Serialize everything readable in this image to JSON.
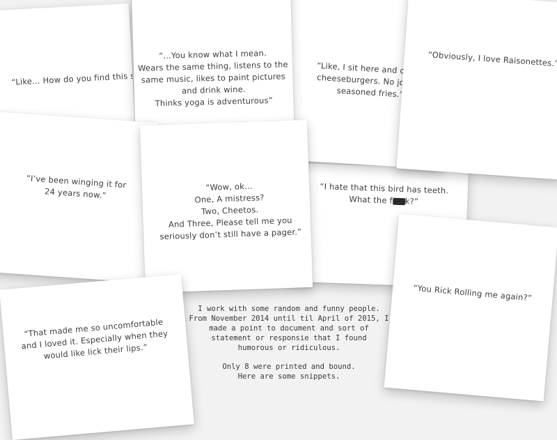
{
  "cards": [
    {
      "id": "bird",
      "lines": [
        "“I hate that this bird has teeth.",
        "What the f"
      ],
      "redacted_tail": "k?”"
    },
    {
      "id": "cheeseburgers",
      "lines": [
        "“Like, I sit here and dream",
        "cheeseburgers. No joke. A",
        "seasoned fries.”"
      ]
    },
    {
      "id": "find-this",
      "lines": [
        "“Like… How do you find this sh"
      ]
    },
    {
      "id": "raisonettes",
      "lines": [
        "“Obviously, I love Raisonettes.”"
      ]
    },
    {
      "id": "you-know",
      "lines": [
        "“...You know what I mean.",
        "Wears the same thing, listens to the",
        "same music, likes to paint pictures",
        "and drink wine.",
        "Thinks yoga is adventurous”"
      ]
    },
    {
      "id": "winging",
      "lines": [
        "“I’ve been winging it for",
        "24 years now.”"
      ]
    },
    {
      "id": "mistress",
      "lines": [
        "“Wow, ok…",
        "One, A mistress?",
        "Two, Cheetos.",
        "And Three, Please tell me you",
        "seriously don’t still have a pager.”"
      ]
    },
    {
      "id": "uncomfortable",
      "lines": [
        "“That made me so uncomfortable",
        "and I loved it. Especially when they",
        "would like lick their lips.”"
      ]
    },
    {
      "id": "rick-rolling",
      "lines": [
        "“You Rick Rolling me again?”"
      ]
    }
  ],
  "intro": {
    "paragraph1": [
      "I work with some random and funny people.",
      "From November 2014 until til April of 2015, I",
      "made a point to document and sort of",
      "statement or responsie that I found",
      "humorous or ridiculous."
    ],
    "paragraph2": [
      "Only 8 were printed and bound.",
      "Here are some snippets."
    ]
  }
}
